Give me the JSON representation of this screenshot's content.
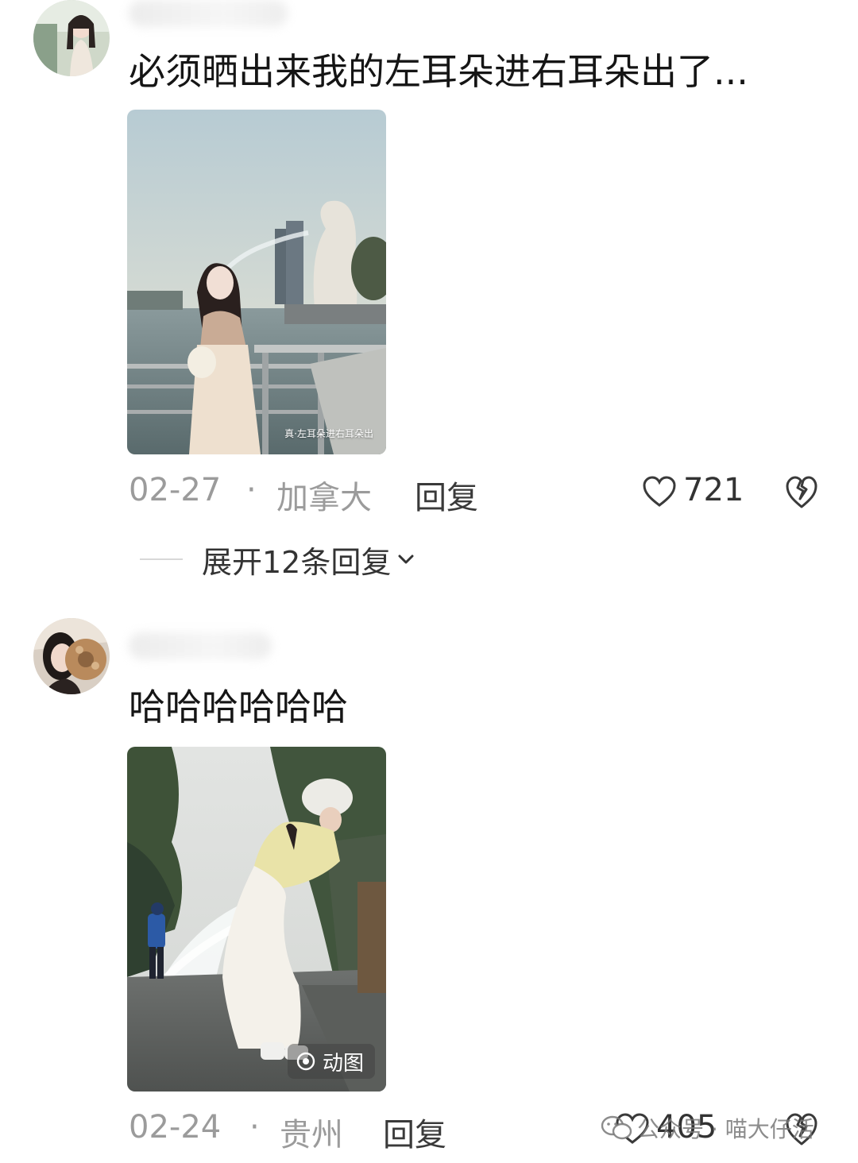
{
  "comments": [
    {
      "text": "必须晒出来我的左耳朵进右耳朵出了...",
      "image_caption": "真·左耳朵进右耳朵出",
      "date": "02-27",
      "separator": "·",
      "location": "加拿大",
      "reply_label": "回复",
      "likes": "721",
      "expand_label": "展开12条回复"
    },
    {
      "text": "哈哈哈哈哈哈",
      "image_badge": "动图",
      "date": "02-24",
      "separator": "·",
      "location": "贵州",
      "reply_label": "回复",
      "likes": "405"
    }
  ],
  "watermark": "公众号 · 喵大仔活",
  "colors": {
    "meta_text": "#9b9b9b",
    "reply_text": "#3a3a3a",
    "body_text": "#151515"
  }
}
